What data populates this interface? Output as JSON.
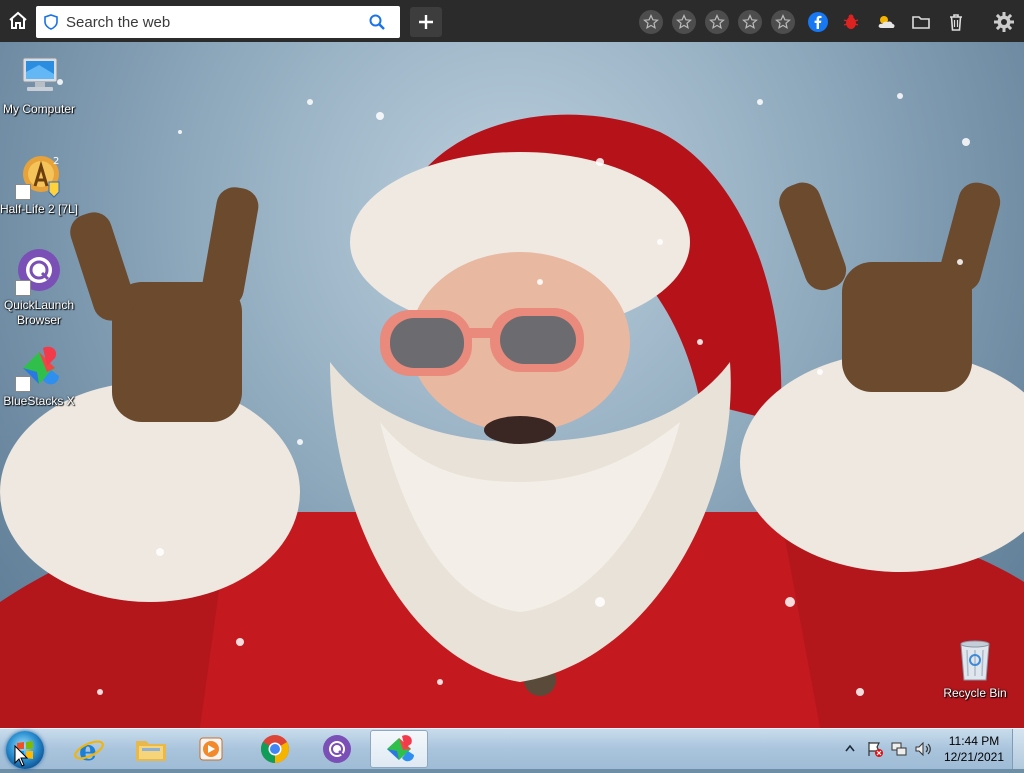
{
  "toolbar": {
    "search_placeholder": "Search the web",
    "star_count": 5,
    "icons": [
      "home-icon",
      "shield-icon",
      "search-icon",
      "plus-icon",
      "star-icon",
      "facebook-icon",
      "bug-icon",
      "weather-icon",
      "folder-icon",
      "trash-icon",
      "gear-icon"
    ]
  },
  "desktop": {
    "icons": [
      {
        "label": "My Computer"
      },
      {
        "label": "Half-Life 2 [7L]"
      },
      {
        "label": "QuickLaunch Browser"
      },
      {
        "label": "BlueStacks X"
      },
      {
        "label": "Recycle Bin"
      }
    ]
  },
  "taskbar": {
    "apps": [
      "internet-explorer-icon",
      "file-explorer-icon",
      "media-player-icon",
      "chrome-icon",
      "quicklaunch-icon",
      "bluestacks-icon"
    ],
    "clock": {
      "time": "11:44 PM",
      "date": "12/21/2021"
    }
  },
  "colors": {
    "toolbar_bg": "#2b2b2b",
    "accent_blue": "#1a73e8",
    "santa_red": "#c41a1f"
  }
}
